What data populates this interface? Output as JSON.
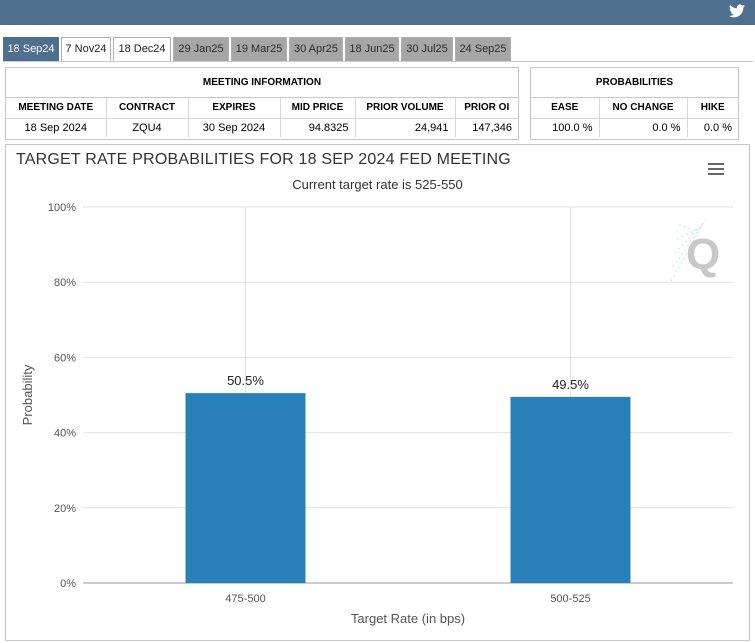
{
  "tabs": [
    "18 Sep24",
    "7 Nov24",
    "18 Dec24",
    "29 Jan25",
    "19 Mar25",
    "30 Apr25",
    "18 Jun25",
    "30 Jul25",
    "24 Sep25"
  ],
  "meeting_info": {
    "title": "MEETING INFORMATION",
    "headers": [
      "MEETING DATE",
      "CONTRACT",
      "EXPIRES",
      "MID PRICE",
      "PRIOR VOLUME",
      "PRIOR OI"
    ],
    "row": [
      "18 Sep 2024",
      "ZQU4",
      "30 Sep 2024",
      "94.8325",
      "24,941",
      "147,346"
    ]
  },
  "probabilities": {
    "title": "PROBABILITIES",
    "headers": [
      "EASE",
      "NO CHANGE",
      "HIKE"
    ],
    "row": [
      "100.0 %",
      "0.0 %",
      "0.0 %"
    ]
  },
  "icons": {
    "twitter": "twitter-icon",
    "menu": "hamburger-menu-icon",
    "watermark": "quikstrike-q-logo"
  },
  "colors": {
    "topbar": "#4f6f8f",
    "bar": "#2980b9",
    "active_tab": "#4f6f8f",
    "inactive_tab": "#a6a6a6"
  },
  "chart_data": {
    "type": "bar",
    "title": "TARGET RATE PROBABILITIES FOR 18 SEP 2024 FED MEETING",
    "subtitle": "Current target rate is 525-550",
    "xlabel": "Target Rate (in bps)",
    "ylabel": "Probability",
    "categories": [
      "475-500",
      "500-525"
    ],
    "values": [
      50.5,
      49.5
    ],
    "data_labels": [
      "50.5%",
      "49.5%"
    ],
    "ylim": [
      0,
      100
    ],
    "yticks": [
      "0%",
      "20%",
      "40%",
      "60%",
      "80%",
      "100%"
    ],
    "grid": true
  }
}
